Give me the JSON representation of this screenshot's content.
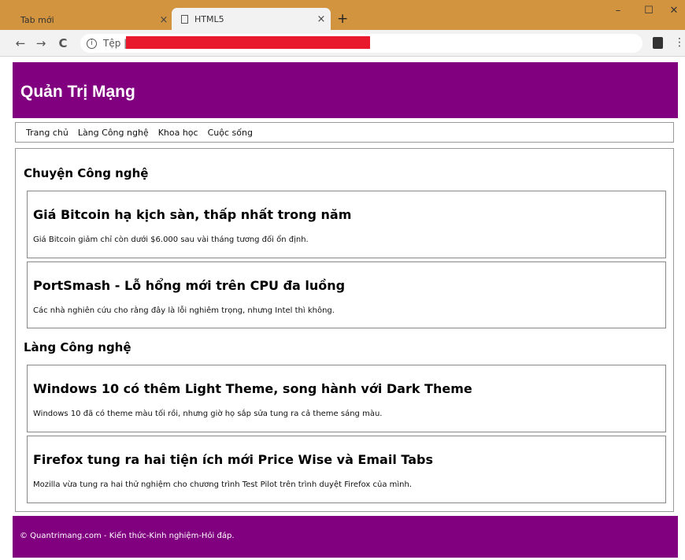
{
  "browser": {
    "tabs": [
      {
        "title": "Tab mới"
      },
      {
        "title": "HTML5"
      }
    ],
    "new_tab": "+",
    "close_glyph": "×",
    "window_controls": {
      "minimize": "–",
      "maximize": "☐",
      "close": "✕"
    },
    "nav": {
      "back": "←",
      "forward": "→",
      "reload": "C"
    },
    "address": {
      "prefix": "Tệp |",
      "info_glyph": "i"
    },
    "menu_glyph": "⋮"
  },
  "site": {
    "title": "Quản Trị Mạng",
    "nav_links": [
      "Trang chủ",
      "Làng Công nghệ",
      "Khoa học",
      "Cuộc sống"
    ],
    "sections": [
      {
        "heading": "Chuyện Công nghệ",
        "articles": [
          {
            "title": "Giá Bitcoin hạ kịch sàn, thấp nhất trong năm",
            "desc": "Giá Bitcoin giảm chỉ còn dưới $6.000 sau vài tháng tương đối ổn định."
          },
          {
            "title": "PortSmash - Lỗ hổng mới trên CPU đa luồng",
            "desc": "Các nhà nghiên cứu cho rằng đây là lỗi nghiêm trọng, nhưng Intel thì không."
          }
        ]
      },
      {
        "heading": "Làng Công nghệ",
        "articles": [
          {
            "title": "Windows 10 có thêm Light Theme, song hành với Dark Theme",
            "desc": "Windows 10 đã có theme màu tối rồi, nhưng giờ họ sắp sửa tung ra cả theme sáng màu."
          },
          {
            "title": "Firefox tung ra hai tiện ích mới Price Wise và Email Tabs",
            "desc": "Mozilla vừa tung ra hai thử nghiệm cho chương trình Test Pilot trên trình duyệt Firefox của mình."
          }
        ]
      }
    ],
    "footer": "© Quantrimang.com - Kiến thức-Kinh nghiệm-Hỏi đáp."
  },
  "colors": {
    "chrome": "#d3943f",
    "brand": "#800080",
    "redaction": "#e8192c"
  }
}
